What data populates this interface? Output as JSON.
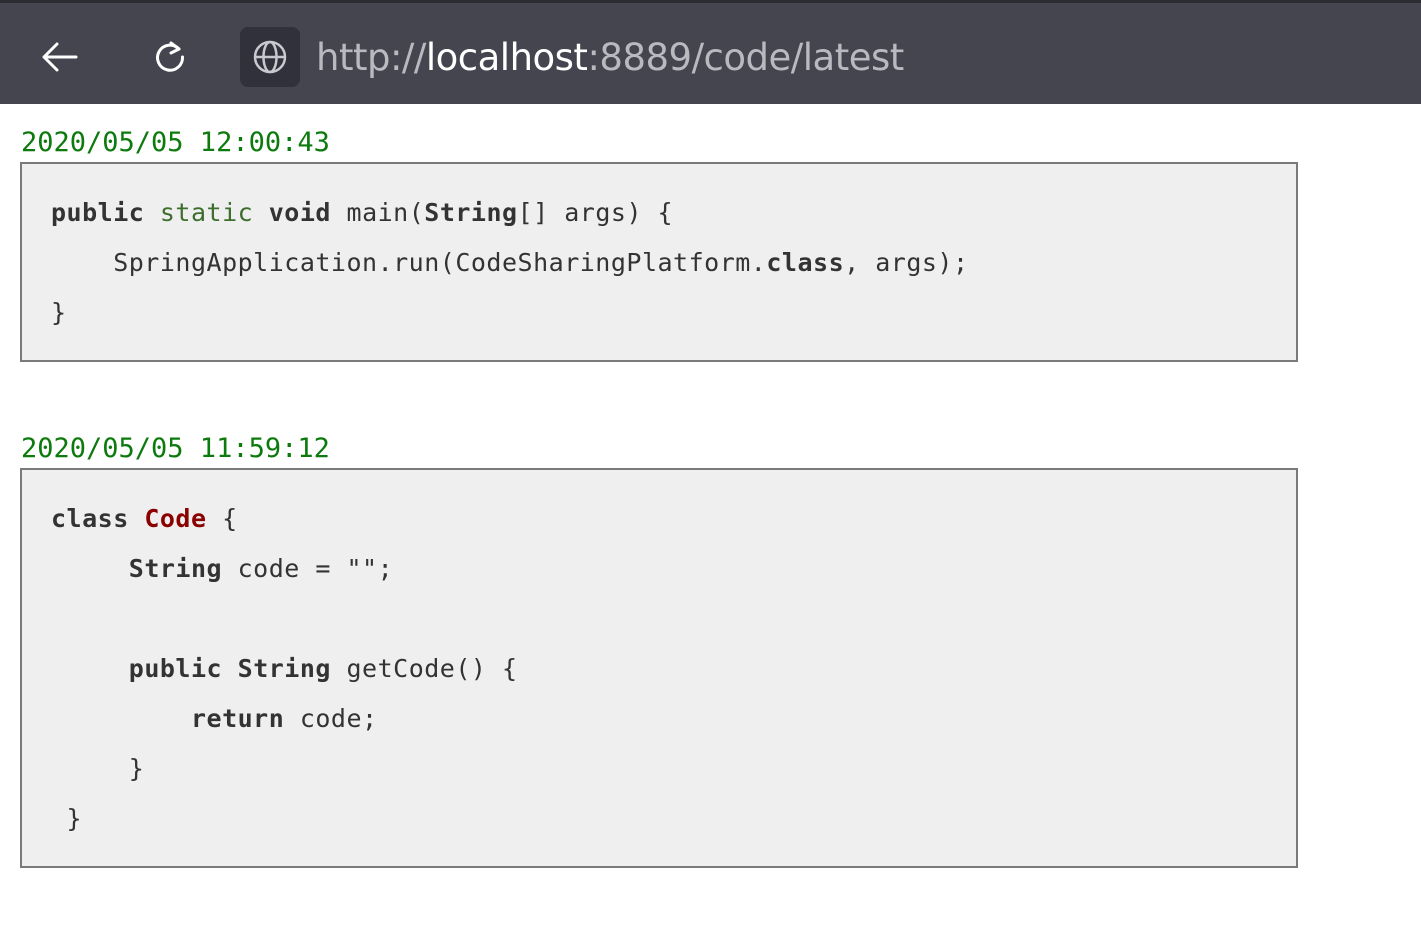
{
  "browser": {
    "url_prefix": "http://",
    "url_host": "localhost",
    "url_rest": ":8889/code/latest",
    "back_icon": "arrow-left-icon",
    "reload_icon": "reload-icon",
    "site_icon": "globe-icon"
  },
  "colors": {
    "toolbar_bg": "#44454e",
    "date_green": "#0d7a0d",
    "code_bg": "#efefef",
    "class_name_red": "#8b0000"
  },
  "snippets": [
    {
      "date": "2020/05/05 12:00:43",
      "lines": [
        [
          {
            "t": "public",
            "k": "kw"
          },
          {
            "t": " "
          },
          {
            "t": "static",
            "k": "kw2"
          },
          {
            "t": " "
          },
          {
            "t": "void",
            "k": "kw"
          },
          {
            "t": " main("
          },
          {
            "t": "String",
            "k": "kw"
          },
          {
            "t": "[] args) {"
          }
        ],
        [
          {
            "t": "    SpringApplication.run(CodeSharingPlatform."
          },
          {
            "t": "class",
            "k": "kw"
          },
          {
            "t": ", args);"
          }
        ],
        [
          {
            "t": "}"
          }
        ]
      ]
    },
    {
      "date": "2020/05/05 11:59:12",
      "lines": [
        [
          {
            "t": "class",
            "k": "kw"
          },
          {
            "t": " "
          },
          {
            "t": "Code",
            "k": "cls"
          },
          {
            "t": " {"
          }
        ],
        [
          {
            "t": "     "
          },
          {
            "t": "String",
            "k": "kw"
          },
          {
            "t": " code = \"\";"
          }
        ],
        [
          {
            "t": ""
          }
        ],
        [
          {
            "t": "     "
          },
          {
            "t": "public",
            "k": "kw"
          },
          {
            "t": " "
          },
          {
            "t": "String",
            "k": "kw"
          },
          {
            "t": " getCode() {"
          }
        ],
        [
          {
            "t": "         "
          },
          {
            "t": "return",
            "k": "kw"
          },
          {
            "t": " code;"
          }
        ],
        [
          {
            "t": "     }"
          }
        ],
        [
          {
            "t": " }"
          }
        ]
      ]
    }
  ]
}
